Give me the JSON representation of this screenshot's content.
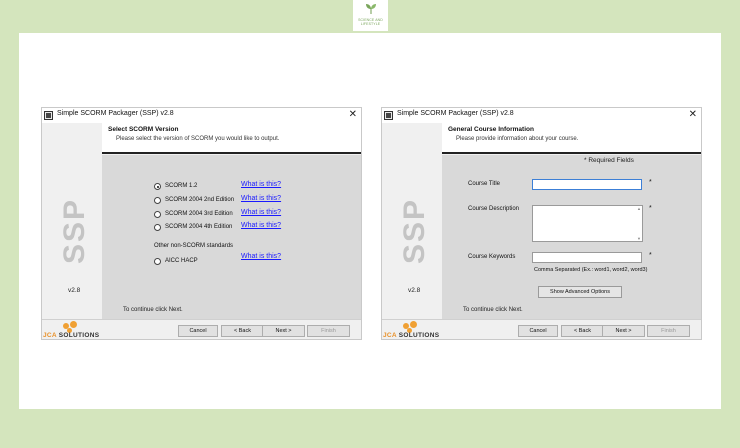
{
  "badge": {
    "line1": "SCIENCE AND",
    "line2": "LIFESTYLE"
  },
  "dialog1": {
    "title": "Simple SCORM Packager (SSP) v2.8",
    "close": "✕",
    "sidebar_logo": "SSP",
    "version": "v2.8",
    "header_title": "Select SCORM Version",
    "header_sub": "Please select the version of SCORM you would like to output.",
    "options": [
      {
        "label": "SCORM 1.2",
        "checked": true
      },
      {
        "label": "SCORM 2004 2nd Edition",
        "checked": false
      },
      {
        "label": "SCORM 2004 3rd Edition",
        "checked": false
      },
      {
        "label": "SCORM 2004 4th Edition",
        "checked": false
      }
    ],
    "other_label": "Other non-SCORM standards",
    "other_option": {
      "label": "AICC HACP",
      "checked": false
    },
    "link_text": "What is this?",
    "footer_hint": "To continue click Next.",
    "buttons": {
      "cancel": "Cancel",
      "back": "< Back",
      "next": "Next >",
      "finish": "Finish"
    }
  },
  "dialog2": {
    "title": "Simple SCORM Packager (SSP) v2.8",
    "close": "✕",
    "sidebar_logo": "SSP",
    "version": "v2.8",
    "header_title": "General Course Information",
    "header_sub": "Please provide information about your course.",
    "required_note": "* Required Fields",
    "fields": {
      "course_title": {
        "label": "Course Title",
        "value": "",
        "required": "*"
      },
      "course_description": {
        "label": "Course Description",
        "value": "",
        "required": "*"
      },
      "course_keywords": {
        "label": "Course Keywords",
        "value": "",
        "required": "*"
      }
    },
    "comma_note": "Comma Separated (Ex.: word1, word2, word3)",
    "advanced_button": "Show Advanced Options",
    "footer_hint": "To continue click Next.",
    "buttons": {
      "cancel": "Cancel",
      "back": "< Back",
      "next": "Next >",
      "finish": "Finish"
    }
  },
  "brand": {
    "name_part1": "JCA",
    "name_part2": " SOLUTIONS"
  },
  "colors": {
    "background": "#d4e5bd",
    "link": "#1a1aff",
    "brand_orange": "#f0a033"
  }
}
